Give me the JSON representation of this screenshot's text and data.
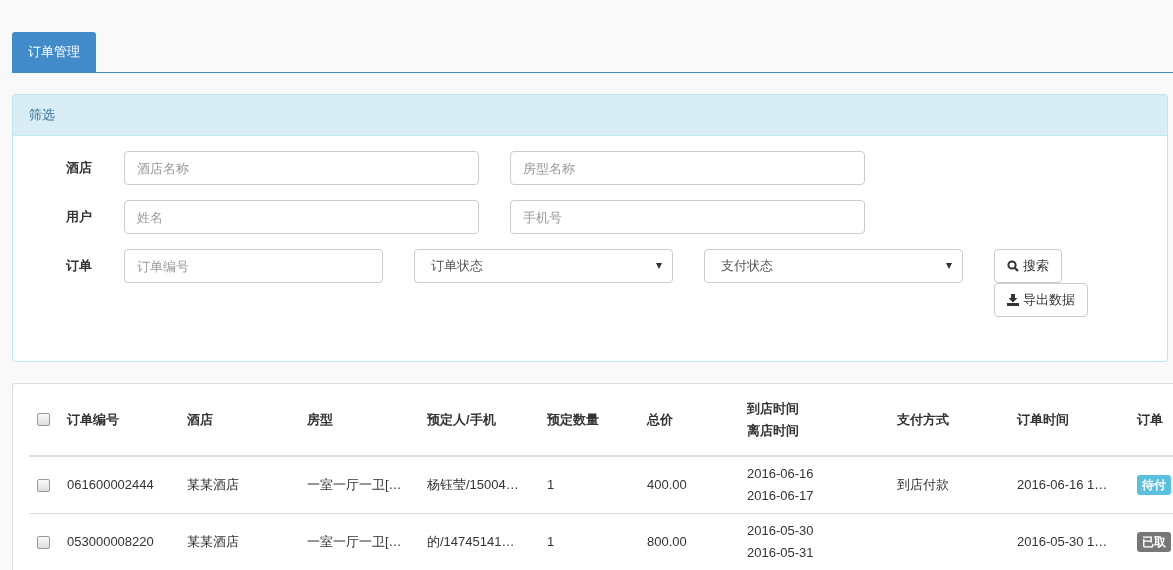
{
  "tabs": [
    {
      "label": "订单管理",
      "selected": true
    }
  ],
  "filter": {
    "title": "筛选",
    "rows": [
      {
        "label": "酒店",
        "fields": [
          {
            "kind": "text",
            "placeholder": "酒店名称"
          },
          {
            "kind": "text",
            "placeholder": "房型名称"
          }
        ]
      },
      {
        "label": "用户",
        "fields": [
          {
            "kind": "text",
            "placeholder": "姓名"
          },
          {
            "kind": "text",
            "placeholder": "手机号"
          }
        ]
      },
      {
        "label": "订单",
        "fields": [
          {
            "kind": "text",
            "placeholder": "订单编号"
          },
          {
            "kind": "select",
            "value": "订单状态"
          },
          {
            "kind": "select",
            "value": "支付状态"
          }
        ]
      }
    ],
    "buttons": [
      {
        "label": "搜索",
        "kind": "search"
      },
      {
        "label": "导出数据",
        "kind": "download"
      }
    ]
  },
  "table": {
    "all_checked": false,
    "columns": [
      {
        "label": "订单编号"
      },
      {
        "label": "酒店"
      },
      {
        "label": "房型"
      },
      {
        "label": "预定人/手机"
      },
      {
        "label": "预定数量"
      },
      {
        "label": "总价"
      },
      {
        "label": "到店时间",
        "second_label": "离店时间"
      },
      {
        "label": "支付方式"
      },
      {
        "label": "订单时间"
      },
      {
        "label": "订单"
      }
    ],
    "rows": [
      {
        "checked": false,
        "cells": [
          [
            "061600002444"
          ],
          [
            "某某酒店"
          ],
          [
            "一室一厅一卫[…"
          ],
          [
            "杨钰莹/15004…"
          ],
          [
            "1"
          ],
          [
            "400.00"
          ],
          [
            "2016-06-16",
            "2016-06-17"
          ],
          [
            "到店付款"
          ],
          [
            "2016-06-16 1…"
          ]
        ],
        "status": {
          "text": "待付",
          "color": "#5bc0de"
        }
      },
      {
        "checked": false,
        "cells": [
          [
            "053000008220"
          ],
          [
            "某某酒店"
          ],
          [
            "一室一厅一卫[…"
          ],
          [
            "的/14745141…"
          ],
          [
            "1"
          ],
          [
            "800.00"
          ],
          [
            "2016-05-30",
            "2016-05-31"
          ],
          [],
          [
            "2016-05-30 1…"
          ]
        ],
        "status": {
          "text": "已取",
          "color": "#777777"
        }
      }
    ]
  }
}
